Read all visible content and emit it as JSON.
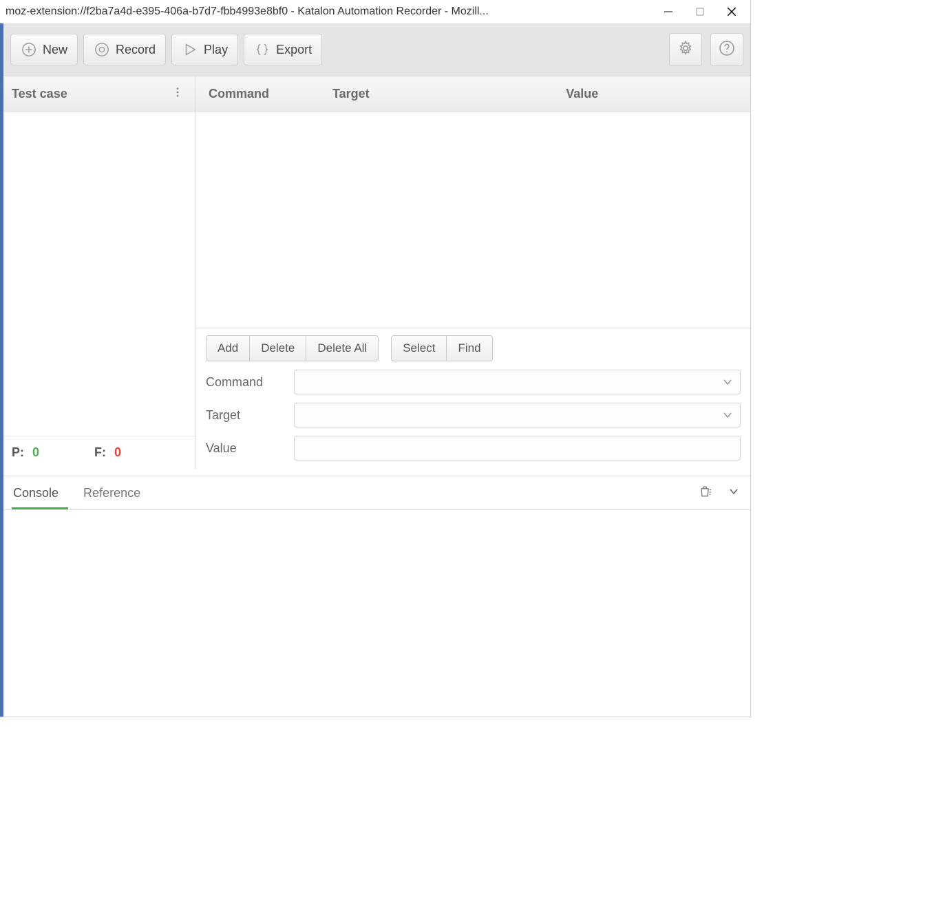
{
  "window": {
    "title": "moz-extension://f2ba7a4d-e395-406a-b7d7-fbb4993e8bf0 - Katalon Automation Recorder - Mozill..."
  },
  "toolbar": {
    "new_label": "New",
    "record_label": "Record",
    "play_label": "Play",
    "export_label": "Export"
  },
  "left": {
    "header": "Test case",
    "pass_label": "P:",
    "pass_value": "0",
    "fail_label": "F:",
    "fail_value": "0"
  },
  "table": {
    "col_command": "Command",
    "col_target": "Target",
    "col_value": "Value"
  },
  "editor": {
    "add": "Add",
    "delete": "Delete",
    "delete_all": "Delete All",
    "select": "Select",
    "find": "Find",
    "command_label": "Command",
    "target_label": "Target",
    "value_label": "Value",
    "command_value": "",
    "target_value": "",
    "value_value": ""
  },
  "console": {
    "tab_console": "Console",
    "tab_reference": "Reference"
  }
}
